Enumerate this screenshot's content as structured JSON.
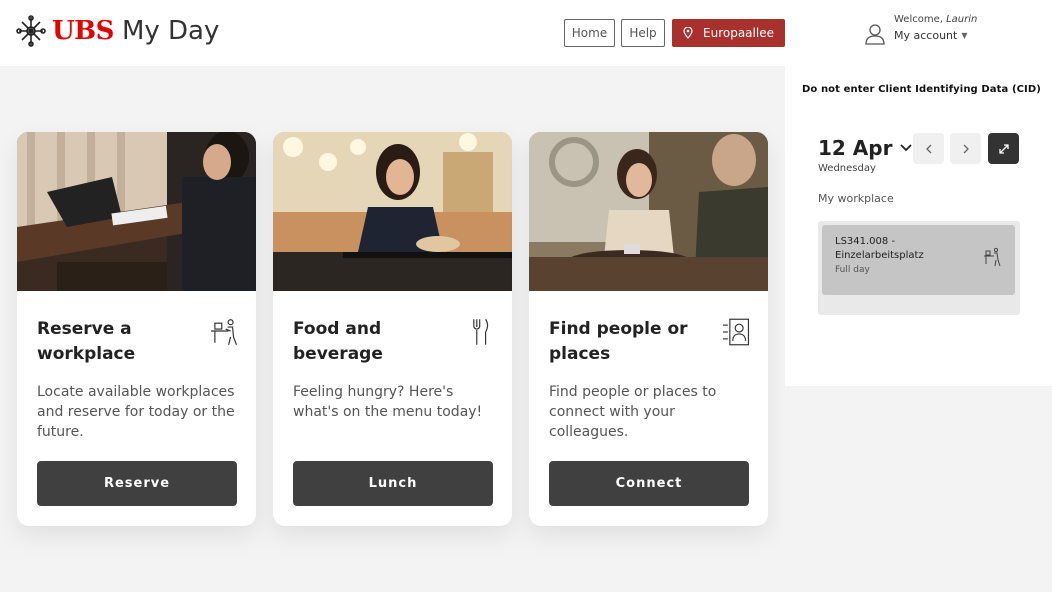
{
  "header": {
    "brand": "UBS",
    "product": "My Day",
    "nav": {
      "home": "Home",
      "help": "Help",
      "location": "Europaallee"
    },
    "account": {
      "welcome_prefix": "Welcome, ",
      "user": "Laurin",
      "label": "My account"
    }
  },
  "cards": [
    {
      "title": "Reserve a workplace",
      "description": "Locate available workplaces and reserve for today or the future.",
      "button": "Reserve",
      "icon": "workplace-desk-icon"
    },
    {
      "title": "Food and beverage",
      "description": "Feeling hungry? Here's what's on the menu today!",
      "button": "Lunch",
      "icon": "fork-knife-icon"
    },
    {
      "title": "Find people or places",
      "description": "Find people or places to connect with your colleagues.",
      "button": "Connect",
      "icon": "person-directory-icon"
    }
  ],
  "panel": {
    "notice": "Do not enter Client Identifying Data (CID)",
    "date": "12 Apr",
    "weekday": "Wednesday",
    "section_label": "My workplace",
    "workplace": {
      "line1": "LS341.008 -",
      "line2": "Einzelarbeitsplatz",
      "duration": "Full day"
    }
  },
  "colors": {
    "brand_red": "#e60000",
    "location_button": "#a8312d",
    "dark_button": "#404040"
  }
}
